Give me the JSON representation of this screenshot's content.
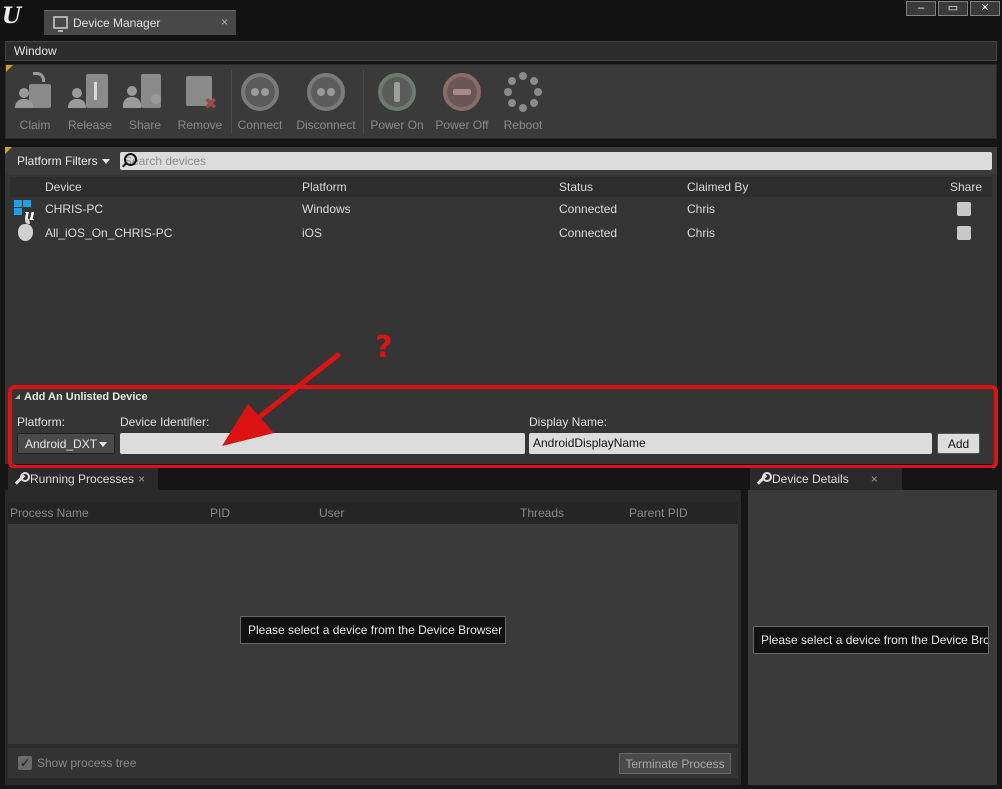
{
  "window": {
    "logo": "U",
    "tab_title": "Device Manager",
    "tab_close": "×",
    "minimize": "–",
    "maximize": "▭",
    "close": "✕"
  },
  "menu": {
    "items": [
      "Window"
    ]
  },
  "toolbar": {
    "buttons": [
      {
        "label": "Claim",
        "icon": "claim-icon"
      },
      {
        "label": "Release",
        "icon": "release-icon"
      },
      {
        "label": "Share",
        "icon": "share-icon"
      },
      {
        "label": "Remove",
        "icon": "remove-icon"
      },
      {
        "label": "Connect",
        "icon": "connect-icon"
      },
      {
        "label": "Disconnect",
        "icon": "disconnect-icon"
      },
      {
        "label": "Power On",
        "icon": "power-on-icon"
      },
      {
        "label": "Power Off",
        "icon": "power-off-icon"
      },
      {
        "label": "Reboot",
        "icon": "reboot-icon"
      }
    ]
  },
  "device_browser": {
    "filter_label": "Platform Filters",
    "search_placeholder": "Search devices",
    "columns": [
      "Device",
      "Platform",
      "Status",
      "Claimed By",
      "Share"
    ],
    "rows": [
      {
        "icon": "windows-icon",
        "device": "CHRIS-PC",
        "platform": "Windows",
        "status": "Connected",
        "claimed_by": "Chris",
        "share": false
      },
      {
        "icon": "apple-icon",
        "device": "All_iOS_On_CHRIS-PC",
        "platform": "iOS",
        "status": "Connected",
        "claimed_by": "Chris",
        "share": false
      }
    ]
  },
  "add_device": {
    "title": "Add An Unlisted Device",
    "platform_label": "Platform:",
    "platform_value": "Android_DXT",
    "identifier_label": "Device Identifier:",
    "identifier_value": "",
    "display_name_label": "Display Name:",
    "display_name_value": "AndroidDisplayName",
    "add_button": "Add"
  },
  "annotation": {
    "question_mark": "?",
    "color": "#dd1212"
  },
  "running_processes": {
    "tab_title": "Running Processes",
    "tab_close": "×",
    "columns": [
      "Process Name",
      "PID",
      "User",
      "Threads",
      "Parent PID"
    ],
    "empty_message": "Please select a device from the Device Browser",
    "show_tree_label": "Show process tree",
    "show_tree_checked": true,
    "terminate_button": "Terminate Process"
  },
  "device_details": {
    "tab_title": "Device Details",
    "tab_close": "×",
    "empty_message": "Please select a device from the Device Browser"
  },
  "colors": {
    "accent": "#d29d2a",
    "windows_blue": "#1ea0e8"
  }
}
